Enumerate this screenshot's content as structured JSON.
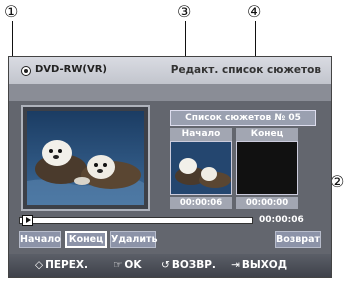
{
  "callouts": {
    "c1": "①",
    "c2": "②",
    "c3": "③",
    "c4": "④"
  },
  "screen": {
    "disc_label": "DVD-RW(VR)",
    "title": "Редакт. список сюжетов",
    "info": "Список сюжетов № 05",
    "start_header": "Начало",
    "end_header": "Конец",
    "start_time": "00:00:06",
    "end_time": "00:00:00",
    "current_time": "00:00:06",
    "progress_fraction": 0.0
  },
  "buttons": {
    "start": "Начало",
    "end": "Конец",
    "delete": "Удалить",
    "back": "Возврат"
  },
  "nav": {
    "move_icon": "◇",
    "move": "ПЕРЕХ.",
    "ok_icon": "☞",
    "ok": "OK",
    "return_icon": "↺",
    "return": "ВОЗВР.",
    "exit_icon": "⇥",
    "exit": "ВЫХОД"
  },
  "colors": {
    "screen_bg": "#63666e",
    "button_bg": "#8c93a8",
    "titlebar": "#c2c5cd"
  }
}
